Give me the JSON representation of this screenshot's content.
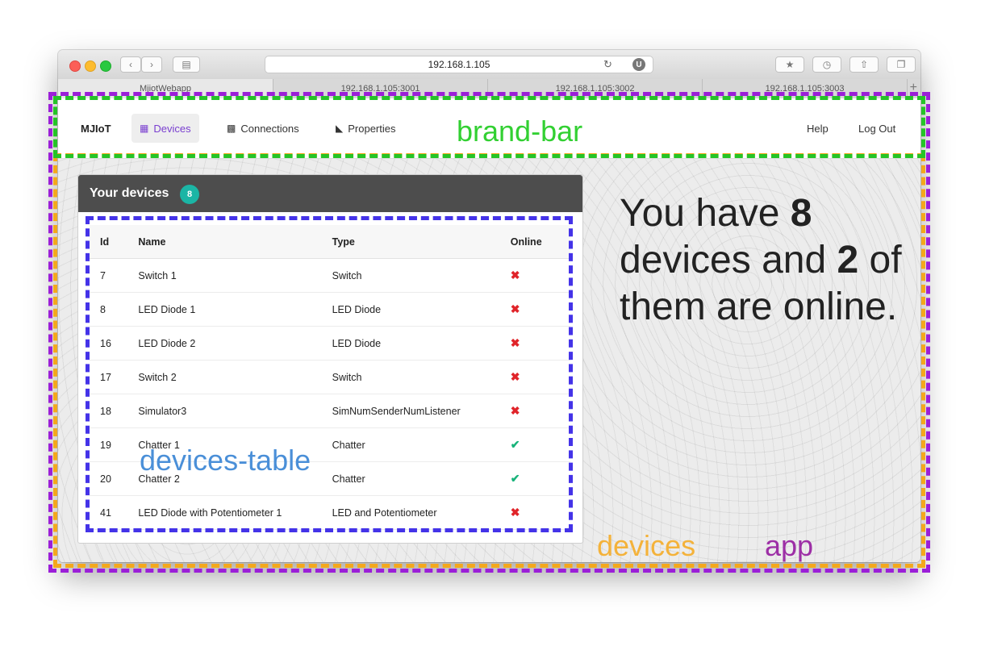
{
  "browser": {
    "url": "192.168.1.105",
    "extension_label": "U",
    "tabs": [
      "MjiotWebapp",
      "192.168.1.105:3001",
      "192.168.1.105:3002",
      "192.168.1.105:3003"
    ]
  },
  "navbar": {
    "brand": "MJIoT",
    "items": [
      {
        "label": "Devices",
        "icon": "chip-icon"
      },
      {
        "label": "Connections",
        "icon": "sitemap-icon"
      },
      {
        "label": "Properties",
        "icon": "area-chart-icon"
      }
    ],
    "right": [
      "Help",
      "Log Out"
    ]
  },
  "devices": {
    "panel_title": "Your devices",
    "count_badge": "8",
    "columns": [
      "Id",
      "Name",
      "Type",
      "Online"
    ],
    "rows": [
      {
        "id": "7",
        "name": "Switch 1",
        "type": "Switch",
        "online": false
      },
      {
        "id": "8",
        "name": "LED Diode 1",
        "type": "LED Diode",
        "online": false
      },
      {
        "id": "16",
        "name": "LED Diode 2",
        "type": "LED Diode",
        "online": false
      },
      {
        "id": "17",
        "name": "Switch 2",
        "type": "Switch",
        "online": false
      },
      {
        "id": "18",
        "name": "Simulator3",
        "type": "SimNumSenderNumListener",
        "online": false
      },
      {
        "id": "19",
        "name": "Chatter 1",
        "type": "Chatter",
        "online": true
      },
      {
        "id": "20",
        "name": "Chatter 2",
        "type": "Chatter",
        "online": true
      },
      {
        "id": "41",
        "name": "LED Diode with Potentiometer 1",
        "type": "LED and Potentiometer",
        "online": false
      }
    ],
    "offline_mark": "✖",
    "online_mark": "✔"
  },
  "summary": {
    "prefix": "You have ",
    "device_count": "8",
    "middle": " devices and ",
    "online_count": "2",
    "suffix": " of them are online."
  },
  "annotations": {
    "brand_bar": "brand-bar",
    "devices_table": "devices-table",
    "devices": "devices",
    "app": "app"
  },
  "colors": {
    "accent": "#7a3fd0",
    "badge": "#1bb5a5",
    "offline": "#e0242a",
    "online": "#18b37a",
    "annotation_app": "#9b1fd8",
    "annotation_devices": "#f4a81c",
    "annotation_brand_bar": "#25c427",
    "annotation_devices_table": "#4433e8"
  }
}
